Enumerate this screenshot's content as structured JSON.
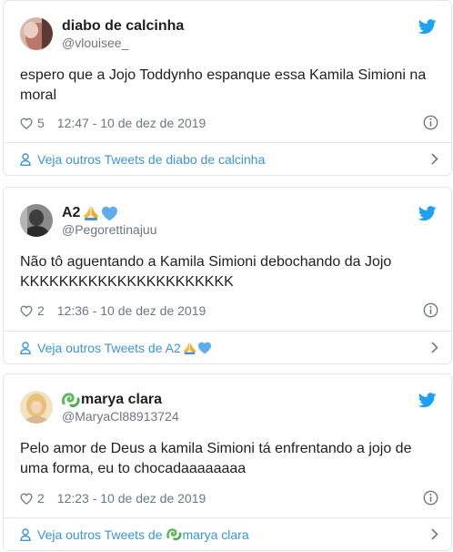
{
  "tweets": [
    {
      "name": "diabo de calcinha",
      "handle": "@vlouisee_",
      "text_lines": [
        "espero que a Jojo Toddynho espanque essa Kamila Simioni na",
        "moral"
      ],
      "likes": "5",
      "timestamp": "12:47 - 10 de dez de 2019",
      "more_label": "Veja outros Tweets de diabo de calcinha",
      "avatar_color": "#c98a7a"
    },
    {
      "name": "A2",
      "handle": "@Pegorettinajuu",
      "text_lines": [
        "Não tô aguentando a Kamila Simioni debochando da Jojo",
        "KKKKKKKKKKKKKKKKKKKKKK"
      ],
      "likes": "2",
      "timestamp": "12:36 - 10 de dez de 2019",
      "more_label": "Veja outros Tweets de A2",
      "avatar_color": "#6b6b6b"
    },
    {
      "name": "marya clara",
      "handle": "@MaryaCl88913724",
      "text_lines": [
        "Pelo amor de Deus a kamila Simioni tá enfrentando a jojo de",
        "uma forma, eu to chocadaaaaaaaa"
      ],
      "likes": "2",
      "timestamp": "12:23 - 10 de dez de 2019",
      "more_label_prefix": "Veja outros Tweets de",
      "more_label_suffix": "marya clara",
      "avatar_color": "#e9c98a"
    }
  ],
  "colors": {
    "twitter_blue": "#1da1f2",
    "link": "#3b94d9",
    "muted": "#697882",
    "border": "#e1e8ed"
  },
  "icons": [
    "twitter-bird-icon",
    "heart-icon",
    "info-icon",
    "person-icon",
    "chevron-right-icon",
    "praying-hands-emoji",
    "blue-heart-emoji",
    "green-clover-emoji"
  ]
}
